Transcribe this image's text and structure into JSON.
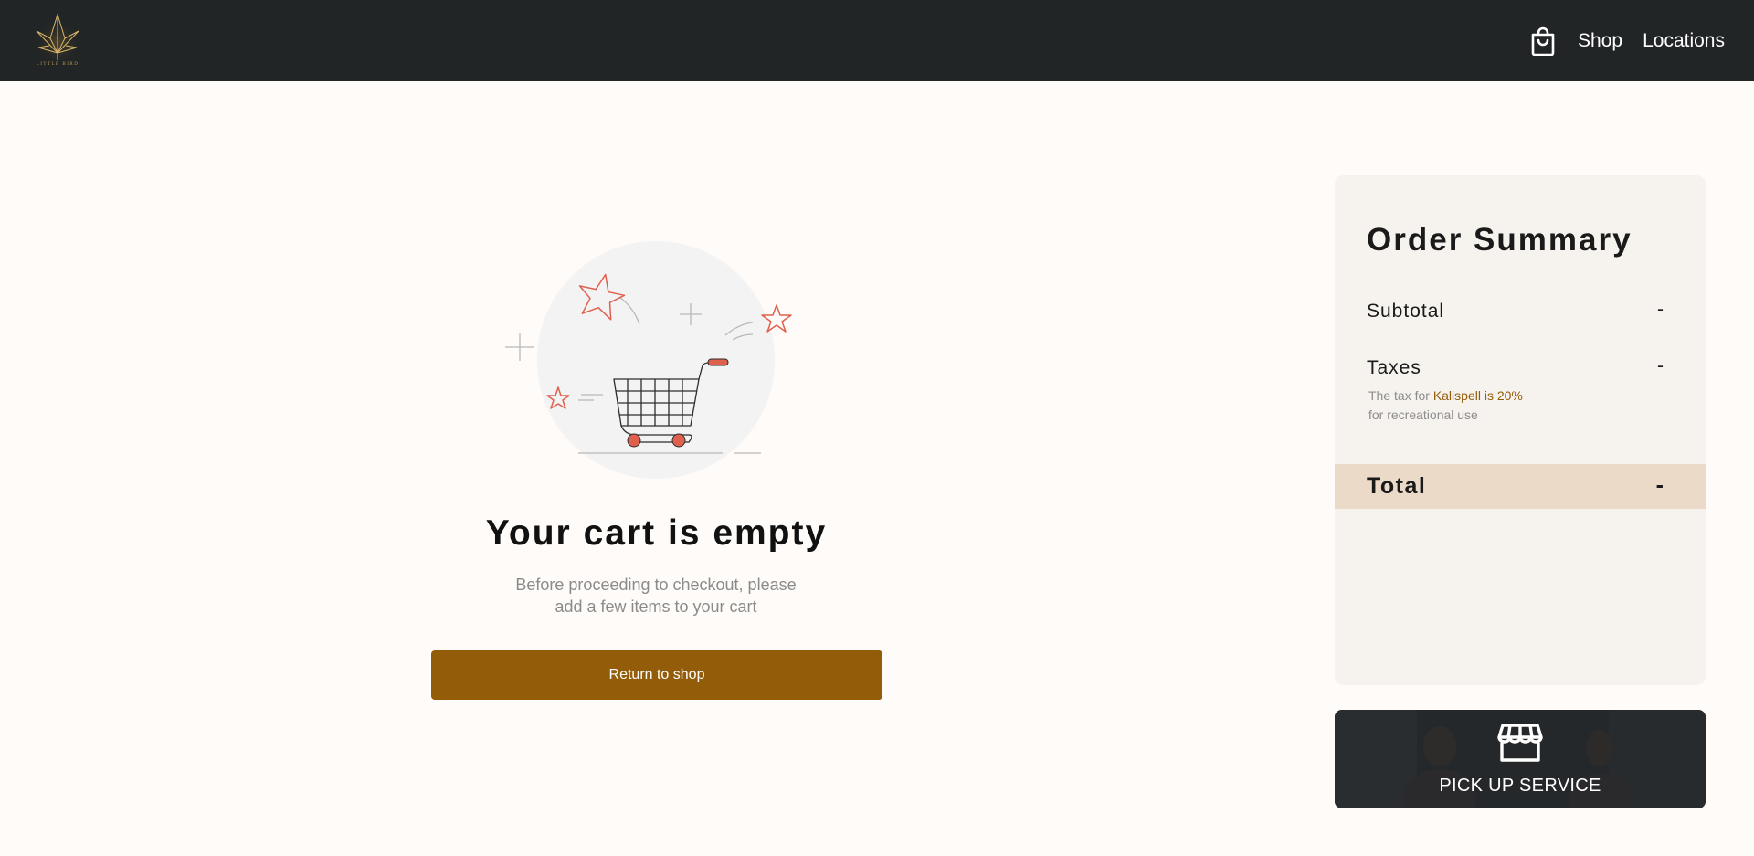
{
  "header": {
    "logo_text": "LITTLE BIRD",
    "nav": {
      "cart_icon": "shopping-bag-icon",
      "shop_label": "Shop",
      "locations_label": "Locations"
    }
  },
  "cart": {
    "illustration_icon": "empty-cart-icon",
    "title": "Your cart is empty",
    "desc_line1": "Before proceeding to checkout, please",
    "desc_line2": "add a few items to your cart",
    "button_label": "Return to shop"
  },
  "summary": {
    "title": "Order Summary",
    "subtotal_label": "Subtotal",
    "subtotal_value": "-",
    "taxes_label": "Taxes",
    "taxes_value": "-",
    "tax_note_prefix": "The tax for ",
    "tax_note_accent": "Kalispell is 20%",
    "tax_note_line2": "for recreational use",
    "total_label": "Total",
    "total_value": "-"
  },
  "pickup": {
    "icon": "storefront-icon",
    "label": "PICK UP SERVICE"
  },
  "colors": {
    "header_bg": "#212526",
    "page_bg": "#fefbf8",
    "accent": "#935c09",
    "summary_bg": "#f6f2ee",
    "total_band": "#ebdac8",
    "illustration_red": "#e0604e"
  }
}
